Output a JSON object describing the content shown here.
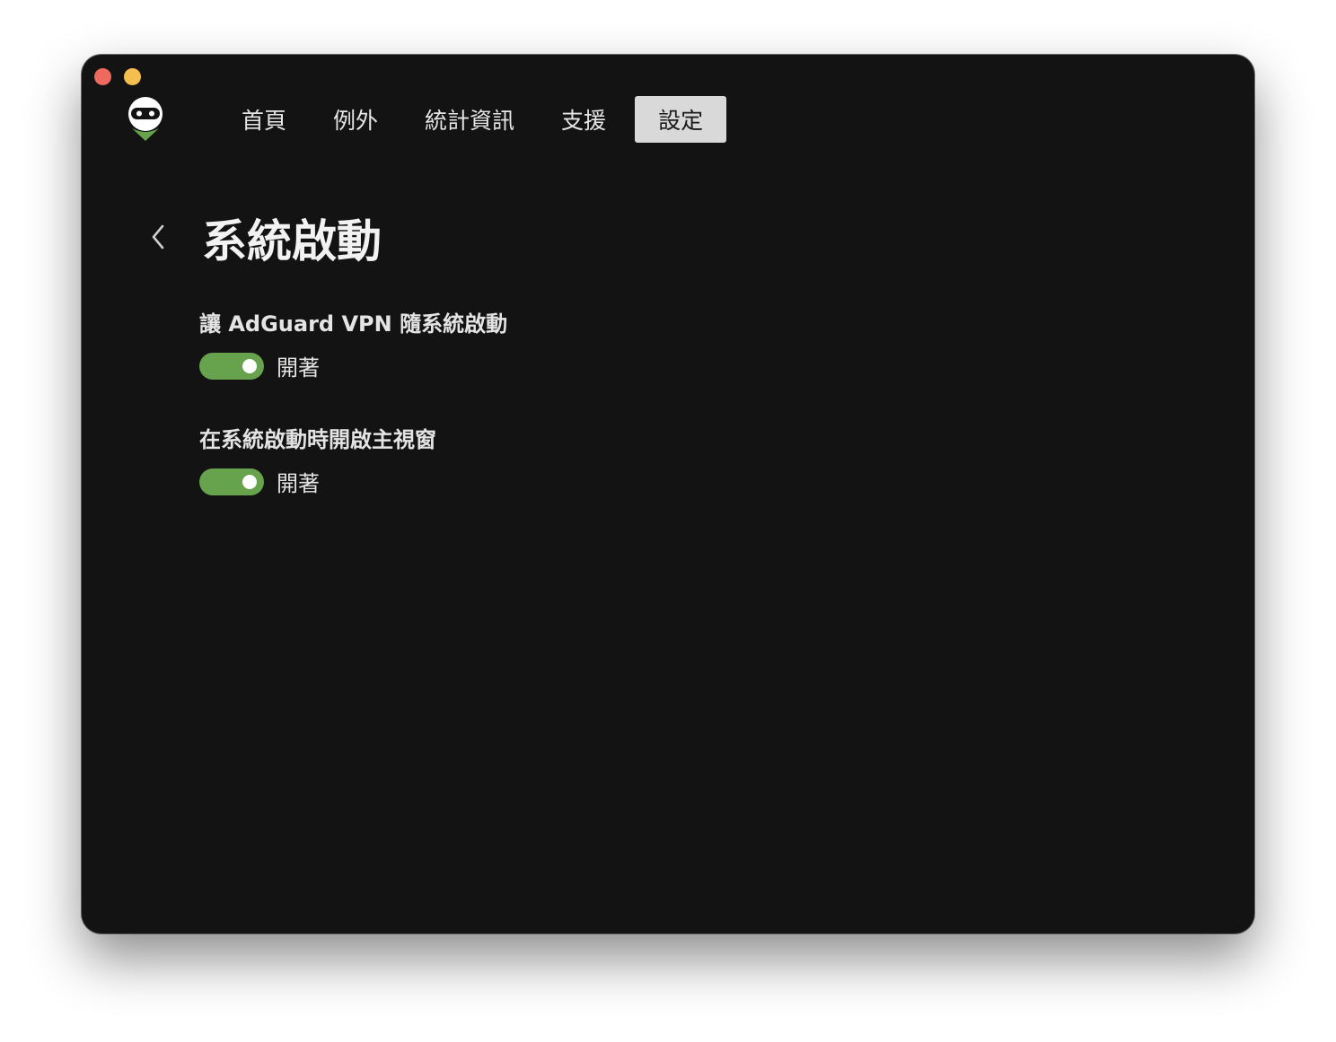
{
  "window": {
    "traffic_lights": [
      "close",
      "minimize"
    ],
    "colors": {
      "background": "#131313",
      "accent": "#67a24d",
      "active_tab_bg": "#d9d9d9"
    }
  },
  "logo": {
    "icon": "adguard-robot-logo-icon"
  },
  "nav": {
    "tabs": [
      {
        "label": "首頁"
      },
      {
        "label": "例外"
      },
      {
        "label": "統計資訊"
      },
      {
        "label": "支援"
      },
      {
        "label": "設定",
        "active": true
      }
    ]
  },
  "page": {
    "back_icon": "chevron-left-icon",
    "title": "系統啟動"
  },
  "settings": [
    {
      "label": "讓 AdGuard VPN 隨系統啟動",
      "state_label": "開著",
      "enabled": true
    },
    {
      "label": "在系統啟動時開啟主視窗",
      "state_label": "開著",
      "enabled": true
    }
  ]
}
